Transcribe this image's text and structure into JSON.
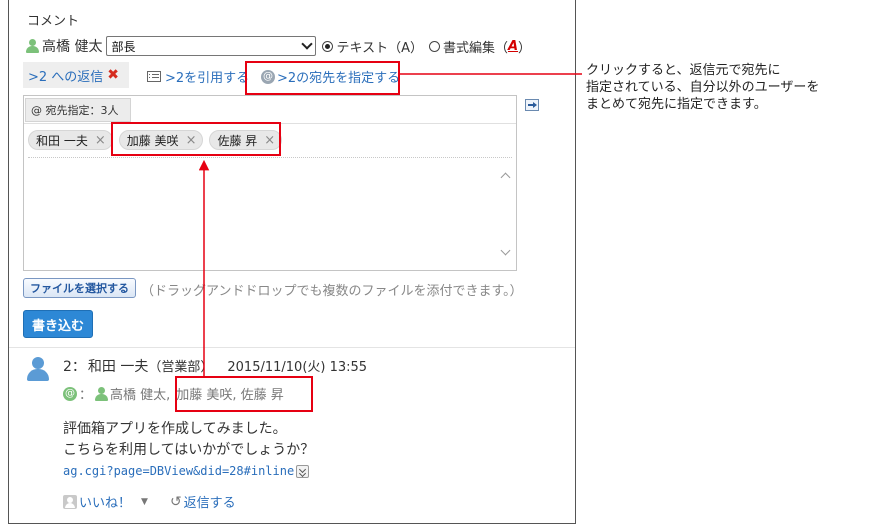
{
  "comment": {
    "title": "コメント",
    "user_name": "高橋 健太",
    "select_value": "部長",
    "radio_text": "テキスト（A）",
    "radio_rich": "書式編集（",
    "radio_rich_a": "A",
    "radio_rich_close": "）"
  },
  "toolbar": {
    "reply_tab": ">2 への返信",
    "quote_link": ">2を引用する",
    "address_link": ">2の宛先を指定する",
    "at_symbol": "@"
  },
  "editor": {
    "address_count": "@ 宛先指定：3人",
    "chips": [
      "和田 一夫",
      "加藤 美咲",
      "佐藤 昇"
    ],
    "chip_remove": "×"
  },
  "file": {
    "select_button": "ファイルを選択する",
    "hint": "（ドラッグアンドドロップでも複数のファイルを添付できます。）"
  },
  "write_button": "書き込む",
  "post": {
    "number": "2：",
    "author": "和田 一夫",
    "dept": "（営業部）",
    "date": "2015/11/10(火) 13:55",
    "at_symbol": "@",
    "addr_colon": "：",
    "addr_user": "高橋 健太,",
    "addr_others": "加藤 美咲, 佐藤 昇",
    "body_line1": "評価箱アプリを作成してみました。",
    "body_line2": "こちらを利用してはいかがでしょうか？",
    "link": "ag.cgi?page=DBView&did=28#inline",
    "like": "いいね！",
    "reply": "返信する"
  },
  "callout": {
    "line1": "クリックすると、返信元で宛先に",
    "line2": "指定されている、自分以外のユーザーを",
    "line3": "まとめて宛先に指定できます。"
  },
  "colors": {
    "accent": "#e60012",
    "link": "#2a6ebb",
    "button": "#2d88d6",
    "user_green": "#7cc17a",
    "avatar_blue": "#5b9bd5"
  }
}
